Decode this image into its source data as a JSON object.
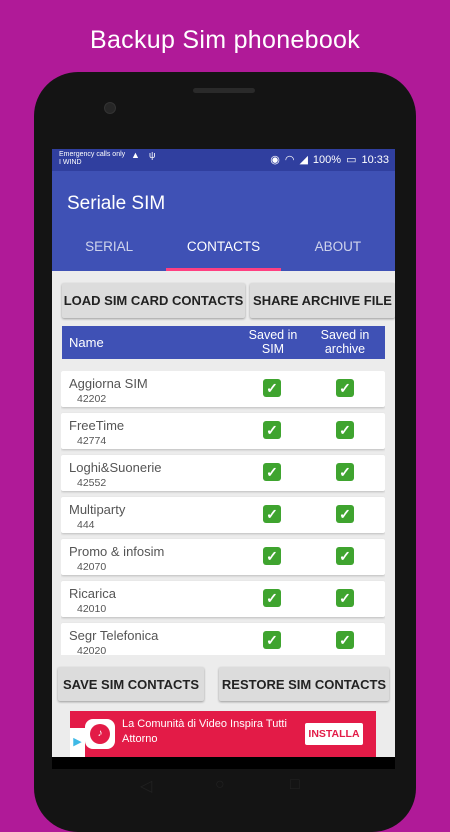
{
  "promo_title": "Backup Sim phonebook",
  "status_bar": {
    "carrier_line1": "Emergency calls only",
    "carrier_line2": "I WIND",
    "battery": "100%",
    "time": "10:33"
  },
  "app": {
    "title": "Seriale SIM",
    "tabs": [
      "SERIAL",
      "CONTACTS",
      "ABOUT"
    ],
    "active_tab": "CONTACTS",
    "accent_color": "#3f51b5",
    "indicator_color": "#ff4081"
  },
  "actions": {
    "load": "LOAD SIM CARD CONTACTS",
    "share": "SHARE ARCHIVE FILE",
    "save": "SAVE SIM CONTACTS",
    "restore": "RESTORE SIM CONTACTS"
  },
  "table": {
    "col_name": "Name",
    "col_sim": "Saved in SIM",
    "col_archive": "Saved in archive"
  },
  "contacts": [
    {
      "name": "Aggiorna SIM",
      "number": "42202",
      "in_sim": true,
      "in_archive": true
    },
    {
      "name": "FreeTime",
      "number": "42774",
      "in_sim": true,
      "in_archive": true
    },
    {
      "name": "Loghi&Suonerie",
      "number": "42552",
      "in_sim": true,
      "in_archive": true
    },
    {
      "name": "Multiparty",
      "number": "444",
      "in_sim": true,
      "in_archive": true
    },
    {
      "name": "Promo & infosim",
      "number": "42070",
      "in_sim": true,
      "in_archive": true
    },
    {
      "name": "Ricarica",
      "number": "42010",
      "in_sim": true,
      "in_archive": true
    },
    {
      "name": "Segr Telefonica",
      "number": "42020",
      "in_sim": true,
      "in_archive": true
    }
  ],
  "ad": {
    "text": "La Comunità di Video Inspira Tutti Attorno",
    "cta": "INSTALLA",
    "color": "#e31b47"
  }
}
